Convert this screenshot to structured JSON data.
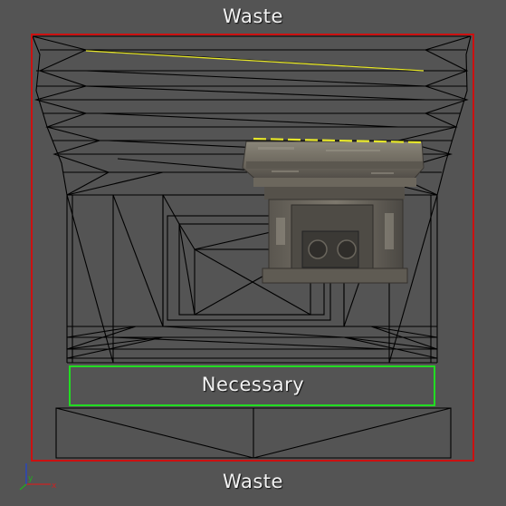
{
  "viewport": {
    "top_label": "Waste",
    "bottom_label": "Waste",
    "necessary_label": "Necessary"
  },
  "colors": {
    "background": "#545454",
    "waste_border": "#cc1111",
    "necessary_border": "#22dd22",
    "highlight_edge": "#e6e62a",
    "wireframe": "#000000"
  },
  "icons": {
    "axis_gizmo": "xyz-axis-icon",
    "pedestal": "stone-pedestal-model"
  },
  "axis_gizmo": {
    "x_label": "x",
    "y_label": "y"
  }
}
